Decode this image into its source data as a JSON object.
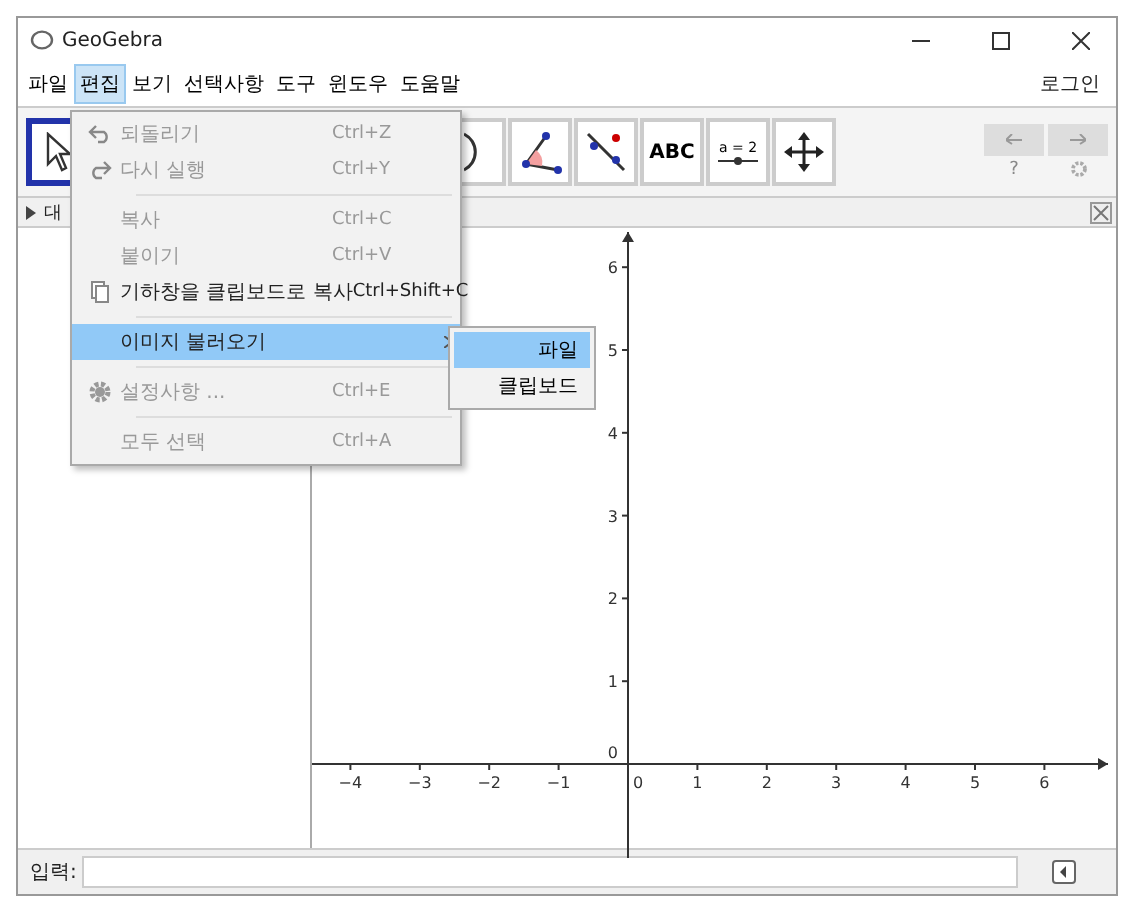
{
  "window": {
    "title": "GeoGebra"
  },
  "menu_bar": [
    {
      "label": "파일",
      "selected": false
    },
    {
      "label": "편집",
      "selected": true
    },
    {
      "label": "보기",
      "selected": false
    },
    {
      "label": "선택사항",
      "selected": false
    },
    {
      "label": "도구",
      "selected": false
    },
    {
      "label": "윈도우",
      "selected": false
    },
    {
      "label": "도움말",
      "selected": false
    }
  ],
  "login": "로그인",
  "tools": [
    {
      "kind": "move",
      "selected": true
    },
    {
      "kind": "circle",
      "selected": false
    },
    {
      "kind": "angle",
      "selected": false
    },
    {
      "kind": "line",
      "selected": false
    },
    {
      "kind": "text",
      "label": "ABC",
      "selected": false
    },
    {
      "kind": "slider",
      "label": "a = 2",
      "selected": false
    },
    {
      "kind": "move-view",
      "selected": false
    }
  ],
  "help": "?",
  "algebra_header": "대",
  "edit_menu": [
    {
      "kind": "item",
      "label": "되돌리기",
      "shortcut": "Ctrl+Z",
      "disabled": true,
      "selected": false
    },
    {
      "kind": "item",
      "label": "다시 실행",
      "shortcut": "Ctrl+Y",
      "disabled": true,
      "selected": false
    },
    {
      "kind": "separator"
    },
    {
      "kind": "item",
      "label": "복사",
      "shortcut": "Ctrl+C",
      "disabled": true,
      "selected": false
    },
    {
      "kind": "item",
      "label": "붙이기",
      "shortcut": "Ctrl+V",
      "disabled": true,
      "selected": false
    },
    {
      "kind": "item",
      "label": "기하창을 클립보드로 복사",
      "shortcut": "Ctrl+Shift+C",
      "disabled": false,
      "selected": false
    },
    {
      "kind": "separator"
    },
    {
      "kind": "submenu",
      "label": "이미지 불러오기",
      "disabled": false,
      "selected": true
    },
    {
      "kind": "separator"
    },
    {
      "kind": "item",
      "label": "설정사항 ...",
      "shortcut": "Ctrl+E",
      "disabled": true,
      "selected": false
    },
    {
      "kind": "separator"
    },
    {
      "kind": "item",
      "label": "모두 선택",
      "shortcut": "Ctrl+A",
      "disabled": true,
      "selected": false
    }
  ],
  "submenu": [
    {
      "label": "파일",
      "selected": true
    },
    {
      "label": "클립보드",
      "selected": false
    }
  ],
  "graphics": {
    "x_labels": [
      "−4",
      "−3",
      "−2",
      "−1",
      "0",
      "1",
      "2",
      "3",
      "4",
      "5",
      "6"
    ],
    "y_labels": [
      "6",
      "5",
      "4",
      "3",
      "2",
      "1",
      "0"
    ]
  },
  "input_bar": {
    "label": "입력:"
  }
}
